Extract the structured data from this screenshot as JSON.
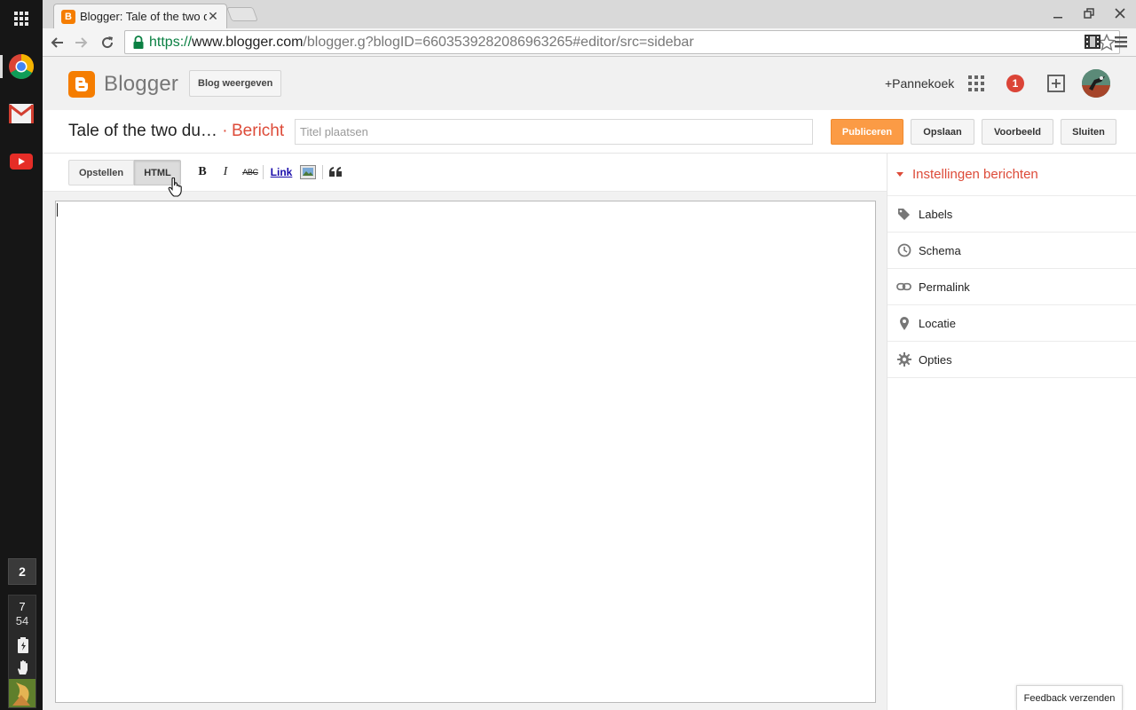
{
  "shelf": {
    "window_count": "2",
    "clock_hour": "7",
    "clock_minute": "54"
  },
  "browser": {
    "tab_title": "Blogger: Tale of the two d",
    "url_scheme": "https://",
    "url_host": "www.blogger.com",
    "url_path": "/blogger.g?blogID=6603539282086963265#editor/src=sidebar"
  },
  "header": {
    "brand": "Blogger",
    "view_blog_label": "Blog weergeven",
    "plus_user": "+Pannekoek",
    "notification_count": "1"
  },
  "post": {
    "blog_title": "Tale of the two du…",
    "separator": " · ",
    "page_kind": "Bericht",
    "title_placeholder": "Titel plaatsen",
    "publish_label": "Publiceren",
    "save_label": "Opslaan",
    "preview_label": "Voorbeeld",
    "close_label": "Sluiten"
  },
  "editor": {
    "compose_tab": "Opstellen",
    "html_tab": "HTML",
    "active_tab": "HTML",
    "bold": "B",
    "italic": "I",
    "strike": "ABC",
    "link": "Link",
    "content": ""
  },
  "sidebar": {
    "title": "Instellingen berichten",
    "items": [
      {
        "label": "Labels",
        "icon": "tag-icon"
      },
      {
        "label": "Schema",
        "icon": "clock-icon"
      },
      {
        "label": "Permalink",
        "icon": "link-icon"
      },
      {
        "label": "Locatie",
        "icon": "location-pin-icon"
      },
      {
        "label": "Opties",
        "icon": "gear-icon"
      }
    ]
  },
  "footer": {
    "feedback_label": "Feedback verzenden"
  },
  "colors": {
    "accent": "#dd4b39",
    "publish": "#fb9b45",
    "brand": "#f57d00"
  }
}
